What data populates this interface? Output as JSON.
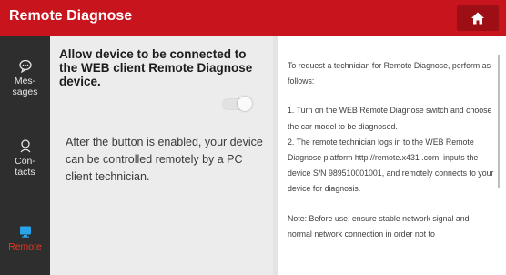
{
  "header": {
    "title": "Remote Diagnose",
    "home_icon": "home-icon",
    "brand_color": "#c8141d"
  },
  "sidebar": {
    "items": [
      {
        "label_line1": "Mes-",
        "label_line2": "sages",
        "icon": "chat-bubble-icon"
      },
      {
        "label_line1": "Con-",
        "label_line2": "tacts",
        "icon": "contact-person-icon"
      },
      {
        "label_line1": "Remote",
        "label_line2": "",
        "icon": "remote-icon"
      }
    ],
    "active_color": "#e8351f"
  },
  "left_panel": {
    "allow_text": "Allow device to be connected to the WEB client Remote Diagnose device.",
    "toggle_state": "off",
    "enabled_text": "After the button is enabled, your device can be controlled remotely by a PC client technician."
  },
  "right_panel": {
    "intro": "To request a technician for Remote Diagnose, perform as follows:",
    "step1": "1. Turn on the WEB Remote Diagnose switch and choose the car model to be diagnosed.",
    "step2": "2. The remote technician logs in to the WEB Remote Diagnose platform http://remote.x431 .com, inputs the device S/N 989510001001, and remotely connects to your device for diagnosis.",
    "note": "Note: Before use, ensure stable network signal and normal network connection in order not to"
  }
}
